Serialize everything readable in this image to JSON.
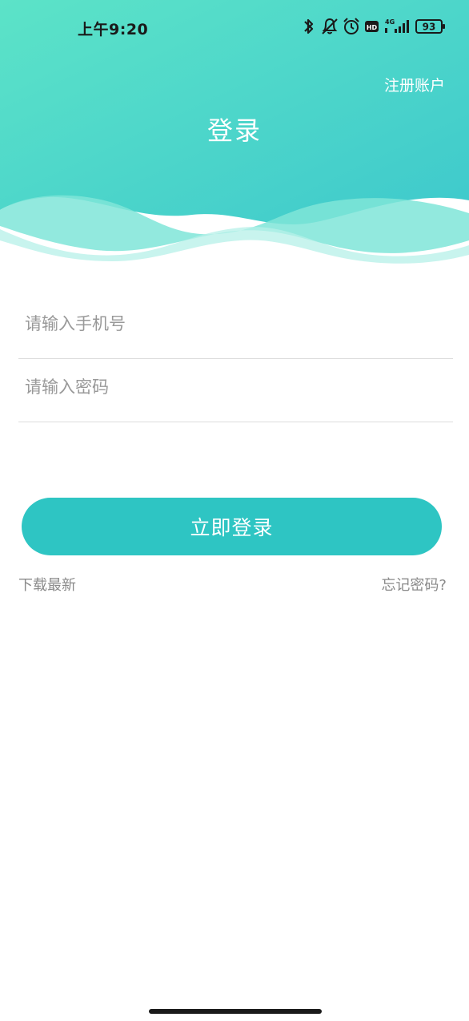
{
  "status_bar": {
    "time": "上午9:20",
    "network": "4G",
    "hd": "HD",
    "battery": "93"
  },
  "header": {
    "register_label": "注册账户",
    "title": "登录"
  },
  "form": {
    "phone_placeholder": "请输入手机号",
    "phone_value": "",
    "password_placeholder": "请输入密码",
    "password_value": ""
  },
  "actions": {
    "login_label": "立即登录",
    "download_label": "下载最新",
    "forgot_label": "忘记密码?"
  },
  "colors": {
    "accent": "#2ec5c3",
    "header_gradient_start": "#5ce3c8",
    "header_gradient_end": "#3ec9cc"
  }
}
